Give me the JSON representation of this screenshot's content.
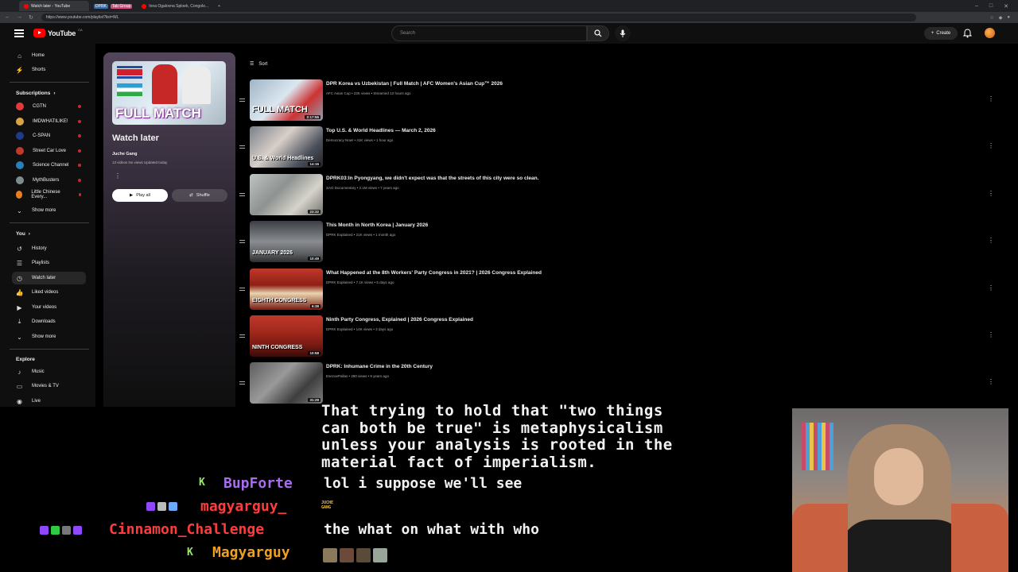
{
  "browser": {
    "active_tab_title": "Watch later - YouTube",
    "tab2_pill1": "DPRK",
    "tab2_pill2": "Tab Group",
    "tab3_title": "Inna Ogalovna Sploek, Congolo...",
    "url": "https://www.youtube.com/playlist?list=WL"
  },
  "yt": {
    "logo_text": "YouTube",
    "country_code": "CA",
    "search_placeholder": "Search",
    "create_label": "Create"
  },
  "sidebar": {
    "home": "Home",
    "shorts": "Shorts",
    "subscriptions_header": "Subscriptions",
    "subscriptions": [
      {
        "name": "CGTN",
        "color": "#e23a3a"
      },
      {
        "name": "IMDWHATILIKE!",
        "color": "#d9a441"
      },
      {
        "name": "C-SPAN",
        "color": "#1e3c8c"
      },
      {
        "name": "Street Car Love",
        "color": "#c0392b"
      },
      {
        "name": "Science Channel",
        "color": "#2980b9"
      },
      {
        "name": "MythBusters",
        "color": "#7f8c8d"
      },
      {
        "name": "Little Chinese Every...",
        "color": "#e67e22"
      }
    ],
    "show_more_1": "Show more",
    "you_header": "You",
    "history": "History",
    "playlists": "Playlists",
    "watch_later": "Watch later",
    "liked_videos": "Liked videos",
    "your_videos": "Your videos",
    "downloads": "Downloads",
    "show_more_2": "Show more",
    "explore_header": "Explore",
    "music": "Music",
    "movies_tv": "Movies & TV",
    "live": "Live"
  },
  "playlist": {
    "thumb_text": "FULL MATCH",
    "title": "Watch later",
    "owner": "Juche Gang",
    "meta": "13 videos   No views   Updated today",
    "play_all": "Play all",
    "shuffle": "Shuffle",
    "sort": "Sort"
  },
  "videos": [
    {
      "title": "DPR Korea vs Uzbekistan | Full Match | AFC Women's Asian Cup™ 2026",
      "meta": "AFC Asian Cup • 22K views • Streamed 12 hours ago",
      "duration": "2:17:55",
      "thumb_text": "FULL MATCH",
      "bg": "linear-gradient(135deg,#9fb5c6,#dbe7ef 45%,#c33 70%,#8da0b0)"
    },
    {
      "title": "Top U.S. & World Headlines — March 2, 2026",
      "meta": "Democracy Now! • 41K views • 1 hour ago",
      "duration": "14:16",
      "thumb_text": "U.S. & World Headlines",
      "bg": "linear-gradient(135deg,#7a7f8a,#d8d0c8 40%,#4a4f5c 75%,#222)"
    },
    {
      "title": "DPRK03:In Pyongyang, we didn't expect was that the streets of this city were so clean.",
      "meta": "SAO Documentary • 2.1M views • 7 years ago",
      "duration": "23:32",
      "thumb_text": "",
      "bg": "linear-gradient(135deg,#bfc3c2,#8e9290 40%,#d6d3cb 70%,#6f706a)"
    },
    {
      "title": "This Month in North Korea | January 2026",
      "meta": "DPRK Explained • 21K views • 1 month ago",
      "duration": "10:49",
      "thumb_text": "JANUARY 2026",
      "bg": "linear-gradient(180deg,#3b3f45,#8a8c8f 50%,#5b5e60 80%,#2c2e30)"
    },
    {
      "title": "What Happened at the 8th Workers' Party Congress in 2021? | 2026 Congress Explained",
      "meta": "DPRK Explained • 7.1K views • 5 days ago",
      "duration": "6:38",
      "thumb_text": "EIGHTH CONGRESS",
      "bg": "linear-gradient(180deg,#c0392b,#8e1f14 40%,#e9d5b0 60%,#7a1b12)"
    },
    {
      "title": "Ninth Party Congress, Explained | 2026 Congress Explained",
      "meta": "DPRK Explained • 14K views • 3 days ago",
      "duration": "10:58",
      "thumb_text": "NINTH CONGRESS",
      "bg": "linear-gradient(180deg,#c0392b,#a1281c 40%,#7a1b12 70%,#3a0c08)"
    },
    {
      "title": "DPRK: Inhumane Crime in the 20th Century",
      "meta": "EsezoePallas • 280 views • 9 years ago",
      "duration": "31:29",
      "thumb_text": "",
      "bg": "linear-gradient(135deg,#5d5d5d,#9a9a9a 40%,#3e3e3e 70%,#7d7d7d)"
    }
  ],
  "stream": {
    "caption_lines": [
      "That trying to hold that \"two things",
      "can both be true\" is metaphysicalism",
      "unless your analysis is rooted in the",
      "material fact of imperialism."
    ],
    "chat": [
      {
        "user": "BupForte",
        "message": "lol i suppose we'll see",
        "user_color": "#a86cf0"
      },
      {
        "user": "magyarguy_",
        "message": "",
        "user_color": "#ff3c3c"
      },
      {
        "user": "Cinnamon_Challenge",
        "message": "the what on what with who",
        "user_color": "#ff3c3c"
      },
      {
        "user": "Magyarguy",
        "message": "",
        "user_color": "#f0a020"
      }
    ],
    "k_badge": "K",
    "juche_label": "JUCHE GANG"
  }
}
